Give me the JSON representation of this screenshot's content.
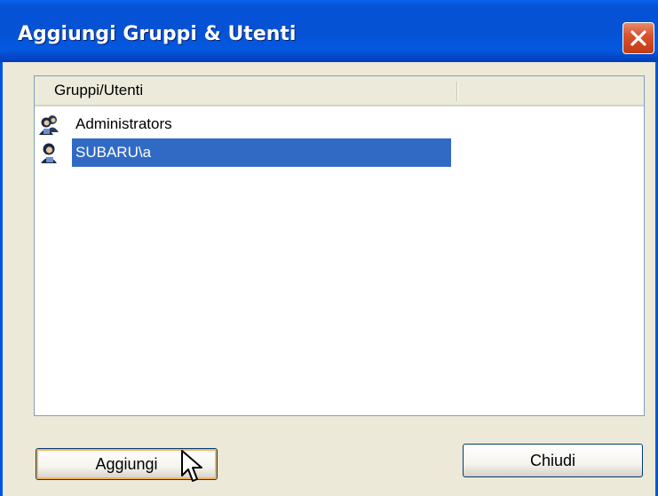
{
  "window": {
    "title": "Aggiungi Gruppi & Utenti"
  },
  "list": {
    "columns": [
      "Gruppi/Utenti",
      ""
    ],
    "rows": [
      {
        "label": "Administrators",
        "icon": "group-icon",
        "selected": false
      },
      {
        "label": "SUBARU\\a",
        "icon": "user-icon",
        "selected": true
      }
    ]
  },
  "buttons": {
    "add_label": "Aggiungi",
    "close_label": "Chiudi"
  },
  "colors": {
    "titlebar": "#0653D8",
    "selection": "#316AC5",
    "dialog_bg": "#ECE9D8",
    "close_button": "#D9532E"
  }
}
